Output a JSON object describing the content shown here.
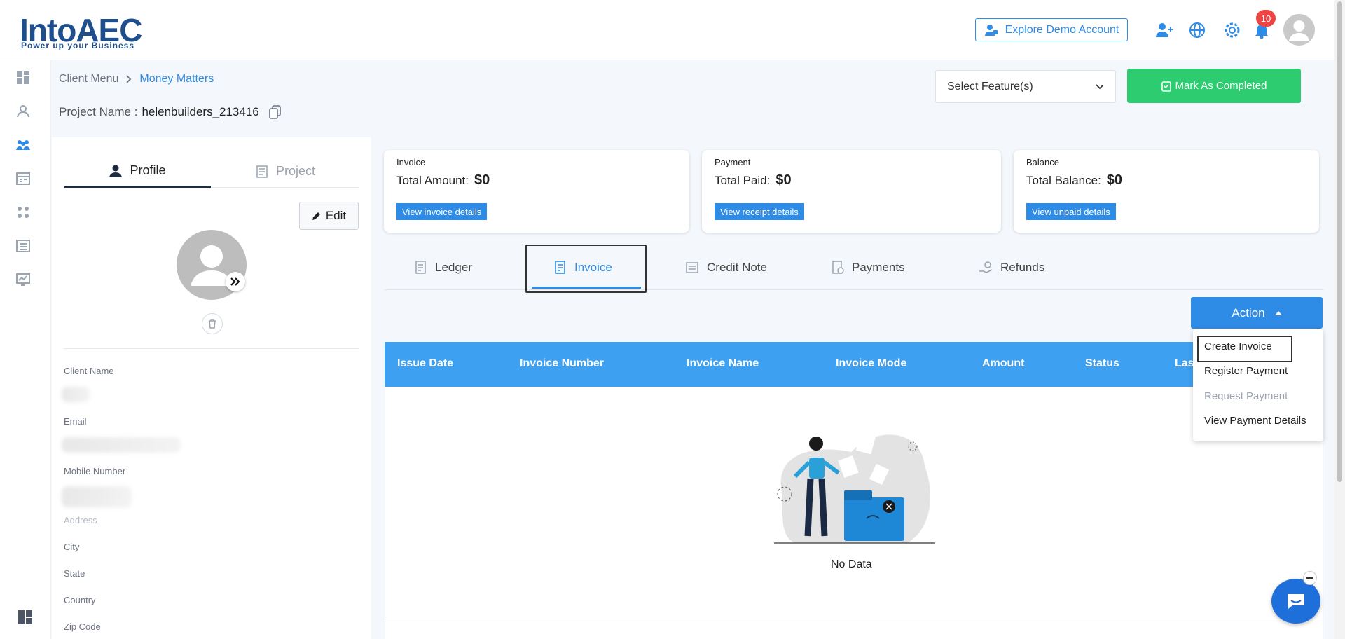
{
  "header": {
    "logo_word": "IntoAEC",
    "logo_tagline": "Power up your Business",
    "demo_label": "Explore Demo Account",
    "notification_count": "10",
    "accent_color": "#2e8be6"
  },
  "breadcrumb": {
    "root": "Client Menu",
    "current": "Money Matters"
  },
  "project": {
    "label": "Project Name :",
    "value": "helenbuilders_213416"
  },
  "toolbar": {
    "select_feature": "Select Feature(s)",
    "mark_completed": "Mark As Completed"
  },
  "profile_tabs": [
    {
      "label": "Profile"
    },
    {
      "label": "Project"
    }
  ],
  "profile": {
    "edit_label": "Edit",
    "fields": [
      {
        "label": "Client Name"
      },
      {
        "label": "Email"
      },
      {
        "label": "Mobile Number"
      },
      {
        "label": "Address"
      },
      {
        "label": "City"
      },
      {
        "label": "State"
      },
      {
        "label": "Country"
      },
      {
        "label": "Zip Code"
      }
    ]
  },
  "cards": [
    {
      "title": "Invoice",
      "line_label": "Total Amount:",
      "amount": "$0",
      "button": "View invoice details"
    },
    {
      "title": "Payment",
      "line_label": "Total Paid:",
      "amount": "$0",
      "button": "View receipt details"
    },
    {
      "title": "Balance",
      "line_label": "Total Balance:",
      "amount": "$0",
      "button": "View unpaid details"
    }
  ],
  "tabs": [
    {
      "label": "Ledger"
    },
    {
      "label": "Invoice"
    },
    {
      "label": "Credit Note"
    },
    {
      "label": "Payments"
    },
    {
      "label": "Refunds"
    }
  ],
  "action": {
    "label": "Action",
    "menu": [
      {
        "label": "Create Invoice",
        "enabled": true
      },
      {
        "label": "Register Payment",
        "enabled": true
      },
      {
        "label": "Request Payment",
        "enabled": false
      },
      {
        "label": "View Payment Details",
        "enabled": true
      }
    ]
  },
  "table": {
    "columns": [
      "Issue Date",
      "Invoice Number",
      "Invoice Name",
      "Invoice Mode",
      "Amount",
      "Status",
      "Las"
    ],
    "empty_text": "No Data"
  }
}
